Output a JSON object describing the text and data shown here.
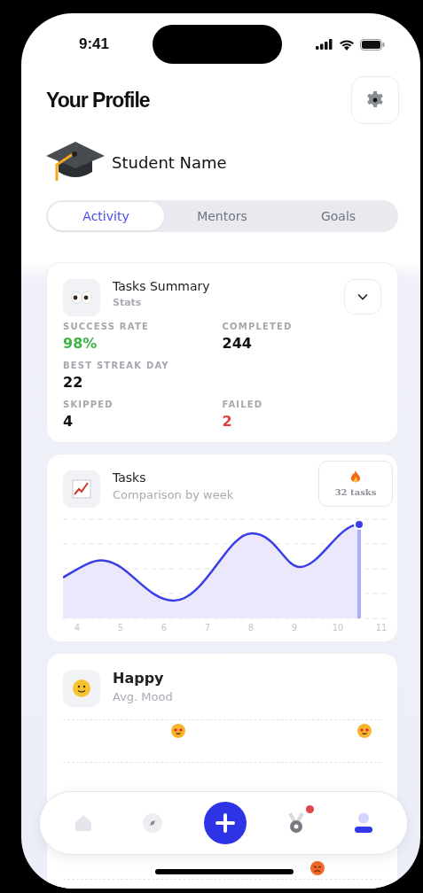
{
  "status_bar": {
    "time": "9:41"
  },
  "header": {
    "title": "Your Profile",
    "user_name": "Student Name"
  },
  "tabs": [
    {
      "label": "Activity",
      "selected": true
    },
    {
      "label": "Mentors",
      "selected": false
    },
    {
      "label": "Goals",
      "selected": false
    }
  ],
  "summary_card": {
    "title": "Tasks Summary",
    "subtitle": "Stats",
    "expanded": false,
    "stats": [
      {
        "label": "SUCCESS RATE",
        "value": "98%",
        "color": "#3fb24a"
      },
      {
        "label": "COMPLETED",
        "value": "244",
        "color": "#111111"
      },
      {
        "label": "BEST STREAK DAY",
        "value": "22",
        "color": "#111111"
      },
      {
        "label": "SKIPPED",
        "value": "4",
        "color": "#111111"
      },
      {
        "label": "FAILED",
        "value": "2",
        "color": "#e2403f"
      }
    ]
  },
  "tasks_card": {
    "title": "Tasks",
    "subtitle": "Comparison by week",
    "tooltip": "32 tasks",
    "x_labels": [
      "4",
      "5",
      "6",
      "7",
      "8",
      "9",
      "10",
      "11"
    ]
  },
  "mood_card": {
    "title": "Happy",
    "subtitle": "Avg. Mood"
  },
  "nav": [
    {
      "kind": "home",
      "selected": false
    },
    {
      "kind": "explore",
      "selected": false
    },
    {
      "kind": "add",
      "selected": false
    },
    {
      "kind": "awards",
      "selected": false,
      "badge": true
    },
    {
      "kind": "profile",
      "selected": true
    }
  ]
}
